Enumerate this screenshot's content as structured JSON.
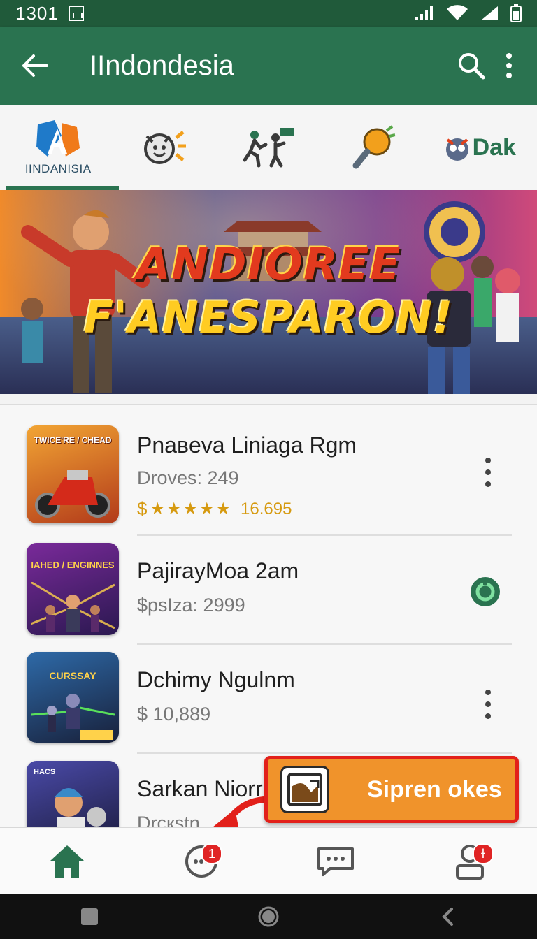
{
  "status_bar": {
    "time": "1301"
  },
  "app_bar": {
    "title": "IIndondesia",
    "back_icon": "arrow-left-icon",
    "search_icon": "search-icon",
    "menu_icon": "more-vert-icon"
  },
  "categories": [
    {
      "label": "IINDANISIA",
      "icon": "a-logo-icon",
      "active": true
    },
    {
      "label": "",
      "icon": "smiley-burst-icon",
      "active": false
    },
    {
      "label": "",
      "icon": "running-people-icon",
      "active": false
    },
    {
      "label": "",
      "icon": "torch-icon",
      "active": false
    },
    {
      "label": "Dak",
      "icon": "mascot-icon",
      "active": false
    }
  ],
  "banner": {
    "line1": "ANDIOREE",
    "line2": "F'ANESPARON!"
  },
  "apps": [
    {
      "name": "Pnaвeva Liniaga Rgm",
      "sub": "Droves: 249",
      "rating_prefix": "$",
      "rating_stars": 5,
      "rating_value": "16.695",
      "action": "kebab",
      "thumb_title": "TWICE'RE / CHEAD",
      "thumb_colors": [
        "#f2a534",
        "#b23a1a"
      ]
    },
    {
      "name": "PajiraуMoa 2am",
      "sub": "$psIza: 2999",
      "action": "install",
      "thumb_title": "IAHED / ENGINNES",
      "thumb_colors": [
        "#7a2a9a",
        "#2a1850"
      ]
    },
    {
      "name": "Dchimy Ngulnm",
      "sub": "$ 10,889",
      "action": "kebab",
      "thumb_title": "CURSSAY",
      "thumb_colors": [
        "#2e6aa8",
        "#18203a"
      ]
    },
    {
      "name": "Sarkan Niorr",
      "sub": "Drcкstn.",
      "action": "none",
      "thumb_title": "HACS",
      "thumb_colors": [
        "#4a4aa8",
        "#1a1a3a"
      ]
    }
  ],
  "toast": {
    "label": "Sipren okes",
    "icon": "image-icon"
  },
  "bottom_nav": [
    {
      "icon": "home-icon",
      "badge": "",
      "active": true
    },
    {
      "icon": "chat-bubble-icon",
      "badge": "1",
      "active": false
    },
    {
      "icon": "message-icon",
      "badge": "",
      "active": false
    },
    {
      "icon": "profile-icon",
      "badge": "ɫ",
      "active": false
    }
  ],
  "colors": {
    "primary": "#2a7350",
    "status": "#205a3a",
    "accent": "#f0932b",
    "badge": "#e02424"
  }
}
